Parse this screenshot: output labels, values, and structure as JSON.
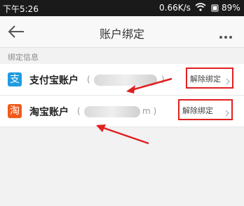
{
  "status_bar": {
    "time": "下午5:26",
    "speed": "0.66K/s",
    "battery": "89%",
    "icons": [
      "wifi-icon",
      "signal-icon",
      "battery-icon"
    ]
  },
  "nav": {
    "title": "账户绑定",
    "icons": [
      "back-arrow-icon",
      "more-icon"
    ]
  },
  "section": {
    "label": "绑定信息"
  },
  "accounts": [
    {
      "icon_glyph": "支",
      "name": "支付宝账户",
      "paren_open": "(",
      "paren_close": ")",
      "action": "解除绑定"
    },
    {
      "icon_glyph": "淘",
      "name": "淘宝账户",
      "paren_open": "(",
      "paren_close": "m )",
      "action": "解除绑定"
    }
  ],
  "annotation_color": "#e02020"
}
